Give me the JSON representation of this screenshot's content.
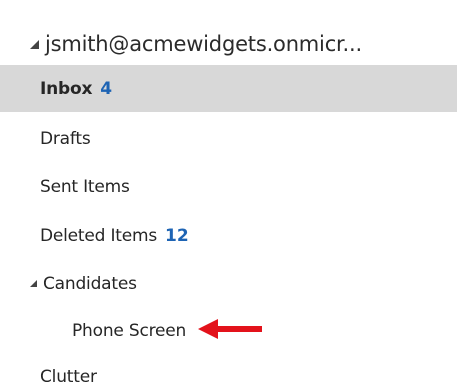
{
  "account": {
    "label": "jsmith@acmewidgets.onmicr..."
  },
  "folders": [
    {
      "label": "Inbox",
      "count": "4"
    },
    {
      "label": "Drafts"
    },
    {
      "label": "Sent Items"
    },
    {
      "label": "Deleted Items",
      "count": "12"
    },
    {
      "label": "Candidates"
    },
    {
      "label": "Phone Screen"
    },
    {
      "label": "Clutter"
    }
  ],
  "colors": {
    "selected_background": "#d8d8d8",
    "unread_count": "#1e64b4",
    "annotation_arrow": "#e3121b"
  },
  "icons": {
    "account_toggle": "expanded-caret-icon",
    "candidates_toggle": "expanded-caret-icon",
    "annotation": "red-arrow-icon"
  }
}
